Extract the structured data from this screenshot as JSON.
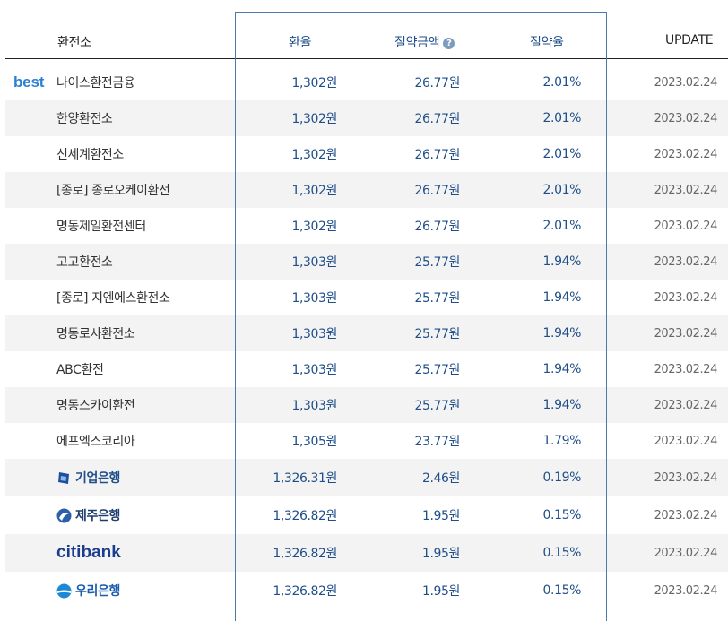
{
  "columns": {
    "exchanger": "환전소",
    "rate": "환율",
    "saving_amount": "절약금액",
    "saving_rate": "절약율",
    "update": "UPDATE"
  },
  "best_label": "best",
  "rows": [
    {
      "name": "나이스환전금융",
      "rate": "1,302원",
      "saving": "26.77원",
      "pct": "2.01%",
      "update": "2023.02.24"
    },
    {
      "name": "한양환전소",
      "rate": "1,302원",
      "saving": "26.77원",
      "pct": "2.01%",
      "update": "2023.02.24"
    },
    {
      "name": "신세계환전소",
      "rate": "1,302원",
      "saving": "26.77원",
      "pct": "2.01%",
      "update": "2023.02.24"
    },
    {
      "name": "[종로] 종로오케이환전",
      "rate": "1,302원",
      "saving": "26.77원",
      "pct": "2.01%",
      "update": "2023.02.24"
    },
    {
      "name": "명동제일환전센터",
      "rate": "1,302원",
      "saving": "26.77원",
      "pct": "2.01%",
      "update": "2023.02.24"
    },
    {
      "name": "고고환전소",
      "rate": "1,303원",
      "saving": "25.77원",
      "pct": "1.94%",
      "update": "2023.02.24"
    },
    {
      "name": "[종로] 지엔에스환전소",
      "rate": "1,303원",
      "saving": "25.77원",
      "pct": "1.94%",
      "update": "2023.02.24"
    },
    {
      "name": "명동로사환전소",
      "rate": "1,303원",
      "saving": "25.77원",
      "pct": "1.94%",
      "update": "2023.02.24"
    },
    {
      "name": "ABC환전",
      "rate": "1,303원",
      "saving": "25.77원",
      "pct": "1.94%",
      "update": "2023.02.24"
    },
    {
      "name": "명동스카이환전",
      "rate": "1,303원",
      "saving": "25.77원",
      "pct": "1.94%",
      "update": "2023.02.24"
    },
    {
      "name": "에프엑스코리아",
      "rate": "1,305원",
      "saving": "23.77원",
      "pct": "1.79%",
      "update": "2023.02.24"
    }
  ],
  "banks": [
    {
      "name": "기업은행",
      "logo": "ibk-logo",
      "rate": "1,326.31원",
      "saving": "2.46원",
      "pct": "0.19%",
      "update": "2023.02.24"
    },
    {
      "name": "제주은행",
      "logo": "jeju-bank-logo",
      "rate": "1,326.82원",
      "saving": "1.95원",
      "pct": "0.15%",
      "update": "2023.02.24"
    },
    {
      "name": "citibank",
      "logo": "citibank-logo",
      "rate": "1,326.82원",
      "saving": "1.95원",
      "pct": "0.15%",
      "update": "2023.02.24"
    },
    {
      "name": "우리은행",
      "logo": "woori-bank-logo",
      "rate": "1,326.82원",
      "saving": "1.95원",
      "pct": "0.15%",
      "update": "2023.02.24"
    }
  ],
  "colors": {
    "accent_blue": "#1f4e89",
    "best_blue": "#2d7fd6",
    "frame": "#4a7aa8",
    "alt_row": "#f3f3f3"
  }
}
